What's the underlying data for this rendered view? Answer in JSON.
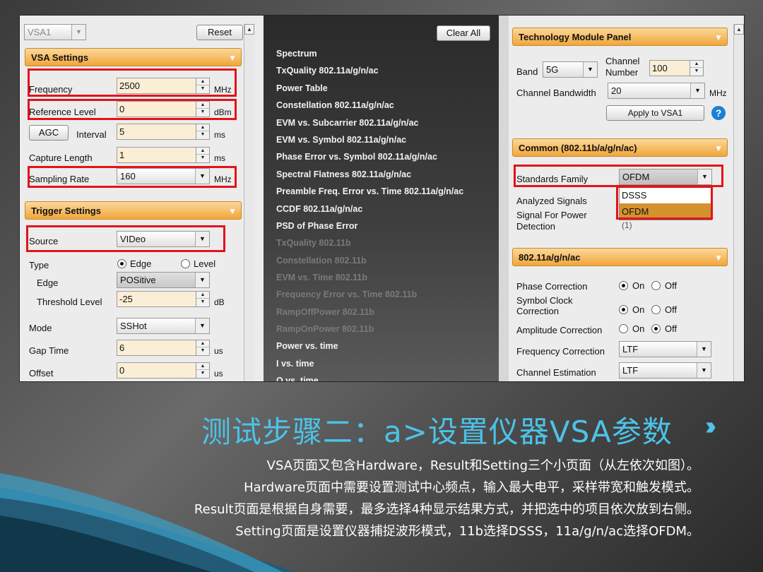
{
  "left": {
    "vsa_select": "VSA1",
    "reset": "Reset",
    "vsa_header": "VSA Settings",
    "frequency": {
      "label": "Frequency",
      "value": "2500",
      "unit": "MHz"
    },
    "ref_level": {
      "label": "Reference Level",
      "value": "0",
      "unit": "dBm"
    },
    "agc": "AGC",
    "interval": {
      "label": "Interval",
      "value": "5",
      "unit": "ms"
    },
    "capture": {
      "label": "Capture Length",
      "value": "1",
      "unit": "ms"
    },
    "sampling": {
      "label": "Sampling Rate",
      "value": "160",
      "unit": "MHz"
    },
    "trigger_header": "Trigger Settings",
    "source": {
      "label": "Source",
      "value": "VIDeo"
    },
    "type": {
      "label": "Type",
      "opt1": "Edge",
      "opt2": "Level"
    },
    "edge": {
      "label": "Edge",
      "value": "POSitive"
    },
    "threshold": {
      "label": "Threshold Level",
      "value": "-25",
      "unit": "dB"
    },
    "mode": {
      "label": "Mode",
      "value": "SSHot"
    },
    "gap": {
      "label": "Gap Time",
      "value": "6",
      "unit": "us"
    },
    "offset": {
      "label": "Offset",
      "value": "0",
      "unit": "us"
    }
  },
  "mid": {
    "clear_all": "Clear All",
    "items": [
      {
        "label": "Spectrum",
        "dim": false
      },
      {
        "label": "TxQuality 802.11a/g/n/ac",
        "dim": false
      },
      {
        "label": "Power Table",
        "dim": false
      },
      {
        "label": "Constellation 802.11a/g/n/ac",
        "dim": false
      },
      {
        "label": "EVM vs. Subcarrier 802.11a/g/n/ac",
        "dim": false
      },
      {
        "label": "EVM vs. Symbol 802.11a/g/n/ac",
        "dim": false
      },
      {
        "label": "Phase Error vs. Symbol 802.11a/g/n/ac",
        "dim": false
      },
      {
        "label": "Spectral Flatness 802.11a/g/n/ac",
        "dim": false
      },
      {
        "label": "Preamble Freq. Error vs. Time 802.11a/g/n/ac",
        "dim": false
      },
      {
        "label": "CCDF 802.11a/g/n/ac",
        "dim": false
      },
      {
        "label": "PSD of Phase Error",
        "dim": false
      },
      {
        "label": "TxQuality 802.11b",
        "dim": true
      },
      {
        "label": "Constellation 802.11b",
        "dim": true
      },
      {
        "label": "EVM vs. Time 802.11b",
        "dim": true
      },
      {
        "label": "Frequency Error vs. Time 802.11b",
        "dim": true
      },
      {
        "label": "RampOffPower 802.11b",
        "dim": true
      },
      {
        "label": "RampOnPower 802.11b",
        "dim": true
      },
      {
        "label": "Power vs. time",
        "dim": false
      },
      {
        "label": "I vs. time",
        "dim": false
      },
      {
        "label": "Q vs. time",
        "dim": false
      }
    ]
  },
  "right": {
    "tech_header": "Technology Module Panel",
    "band": {
      "label": "Band",
      "value": "5G"
    },
    "channel_number": {
      "label1": "Channel",
      "label2": "Number",
      "value": "100"
    },
    "bandwidth": {
      "label": "Channel Bandwidth",
      "value": "20",
      "unit": "MHz"
    },
    "apply": "Apply to VSA1",
    "help": "?",
    "common_header": "Common (802.11b/a/g/n/ac)",
    "standards": {
      "label": "Standards Family",
      "value": "OFDM",
      "options": [
        "DSSS",
        "OFDM"
      ]
    },
    "analyzed": "Analyzed Signals",
    "signal_power1": "Signal For Power",
    "signal_power2": "Detection",
    "hidden_value": "(1)",
    "ofdm_header": "802.11a/g/n/ac",
    "phase": "Phase Correction",
    "symbol1": "Symbol Clock",
    "symbol2": "Correction",
    "amplitude": "Amplitude Correction",
    "on": "On",
    "off": "Off",
    "freq_corr": {
      "label": "Frequency Correction",
      "value": "LTF"
    },
    "chan_est": {
      "label": "Channel Estimation",
      "value": "LTF"
    }
  },
  "slide": {
    "title": "测试步骤二：a>设置仪器VSA参数",
    "lines": [
      "VSA页面又包含Hardware，Result和Setting三个小页面（从左依次如图）。",
      "Hardware页面中需要设置测试中心频点，输入最大电平，采样带宽和触发模式。",
      "Result页面是根据自身需要，最多选择4种显示结果方式，并把选中的项目依次放到右侧。",
      "Setting页面是设置仪器捕捉波形模式，11b选择DSSS，11a/g/n/ac选择OFDM。"
    ]
  },
  "colors": {
    "accent": "#f1a63a",
    "highlight": "#e2131b",
    "title": "#4cc3e8"
  }
}
